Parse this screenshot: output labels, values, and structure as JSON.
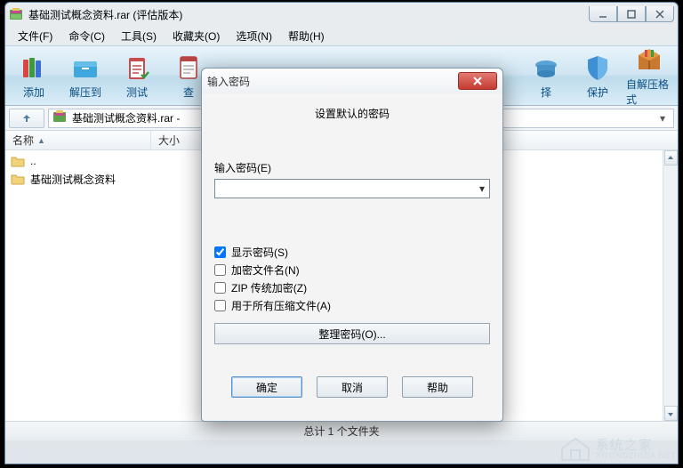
{
  "window": {
    "title": "基础测试概念资料.rar (评估版本)"
  },
  "menu": {
    "file": "文件(F)",
    "command": "命令(C)",
    "tools": "工具(S)",
    "favorites": "收藏夹(O)",
    "options": "选项(N)",
    "help": "帮助(H)"
  },
  "toolbar": {
    "add": "添加",
    "extract": "解压到",
    "test": "测试",
    "view": "查",
    "opt": "择",
    "protect": "保护",
    "sfx": "自解压格式"
  },
  "path": {
    "label": "基础测试概念资料.rar -"
  },
  "list": {
    "col_name": "名称",
    "col_size": "大小",
    "rows": [
      {
        "name": ".."
      },
      {
        "name": "基础测试概念资料"
      }
    ]
  },
  "status": {
    "text": "总计 1 个文件夹"
  },
  "dialog": {
    "title": "输入密码",
    "subtitle": "设置默认的密码",
    "pw_label": "输入密码(E)",
    "pw_value": "",
    "show_pw": "显示密码(S)",
    "encrypt_names": "加密文件名(N)",
    "zip_legacy": "ZIP 传统加密(Z)",
    "for_all": "用于所有压缩文件(A)",
    "organize": "整理密码(O)...",
    "ok": "确定",
    "cancel": "取消",
    "help": "帮助",
    "show_pw_checked": true
  },
  "watermark": {
    "text1": "系统之家",
    "text2": "XITONGZHIJIA.NET"
  }
}
